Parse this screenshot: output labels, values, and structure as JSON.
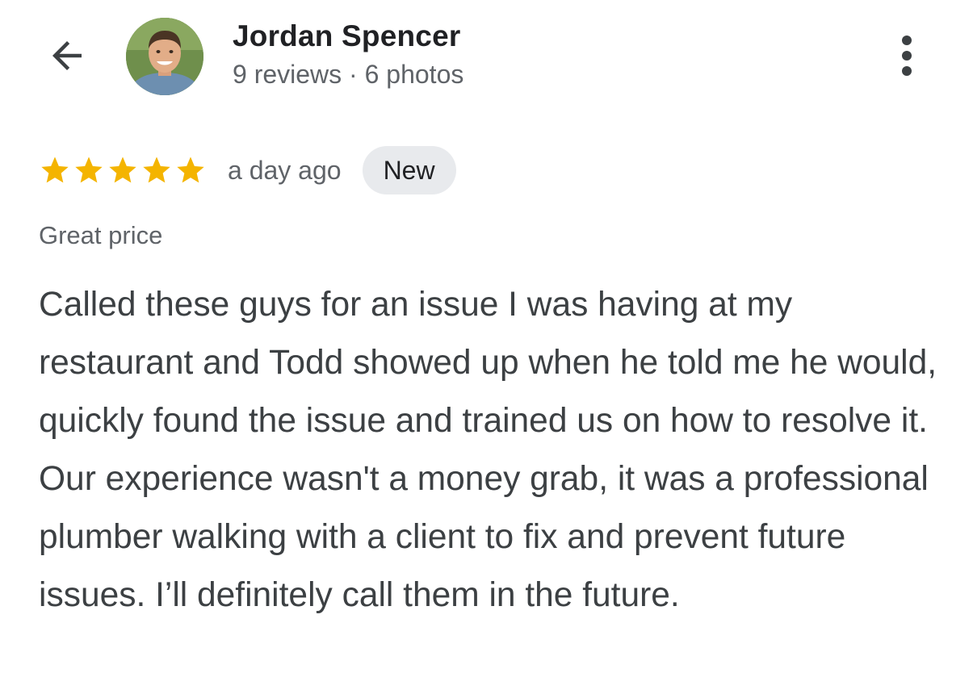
{
  "header": {
    "back_icon": "arrow-left-icon",
    "reviewer_name": "Jordan Spencer",
    "reviewer_meta": "9 reviews · 6 photos",
    "more_icon": "more-vertical-icon"
  },
  "review": {
    "rating": 5,
    "max_rating": 5,
    "star_color": "#f4b400",
    "date": "a day ago",
    "badge": "New",
    "tag": "Great price",
    "text": "Called these guys for an issue I was having at my restaurant and Todd showed up when he told me he would, quickly found the issue and trained us on how to resolve it. Our experience wasn't a money grab, it was a professional plumber walking with a client to fix and prevent future issues. I’ll definitely call them in the future."
  }
}
